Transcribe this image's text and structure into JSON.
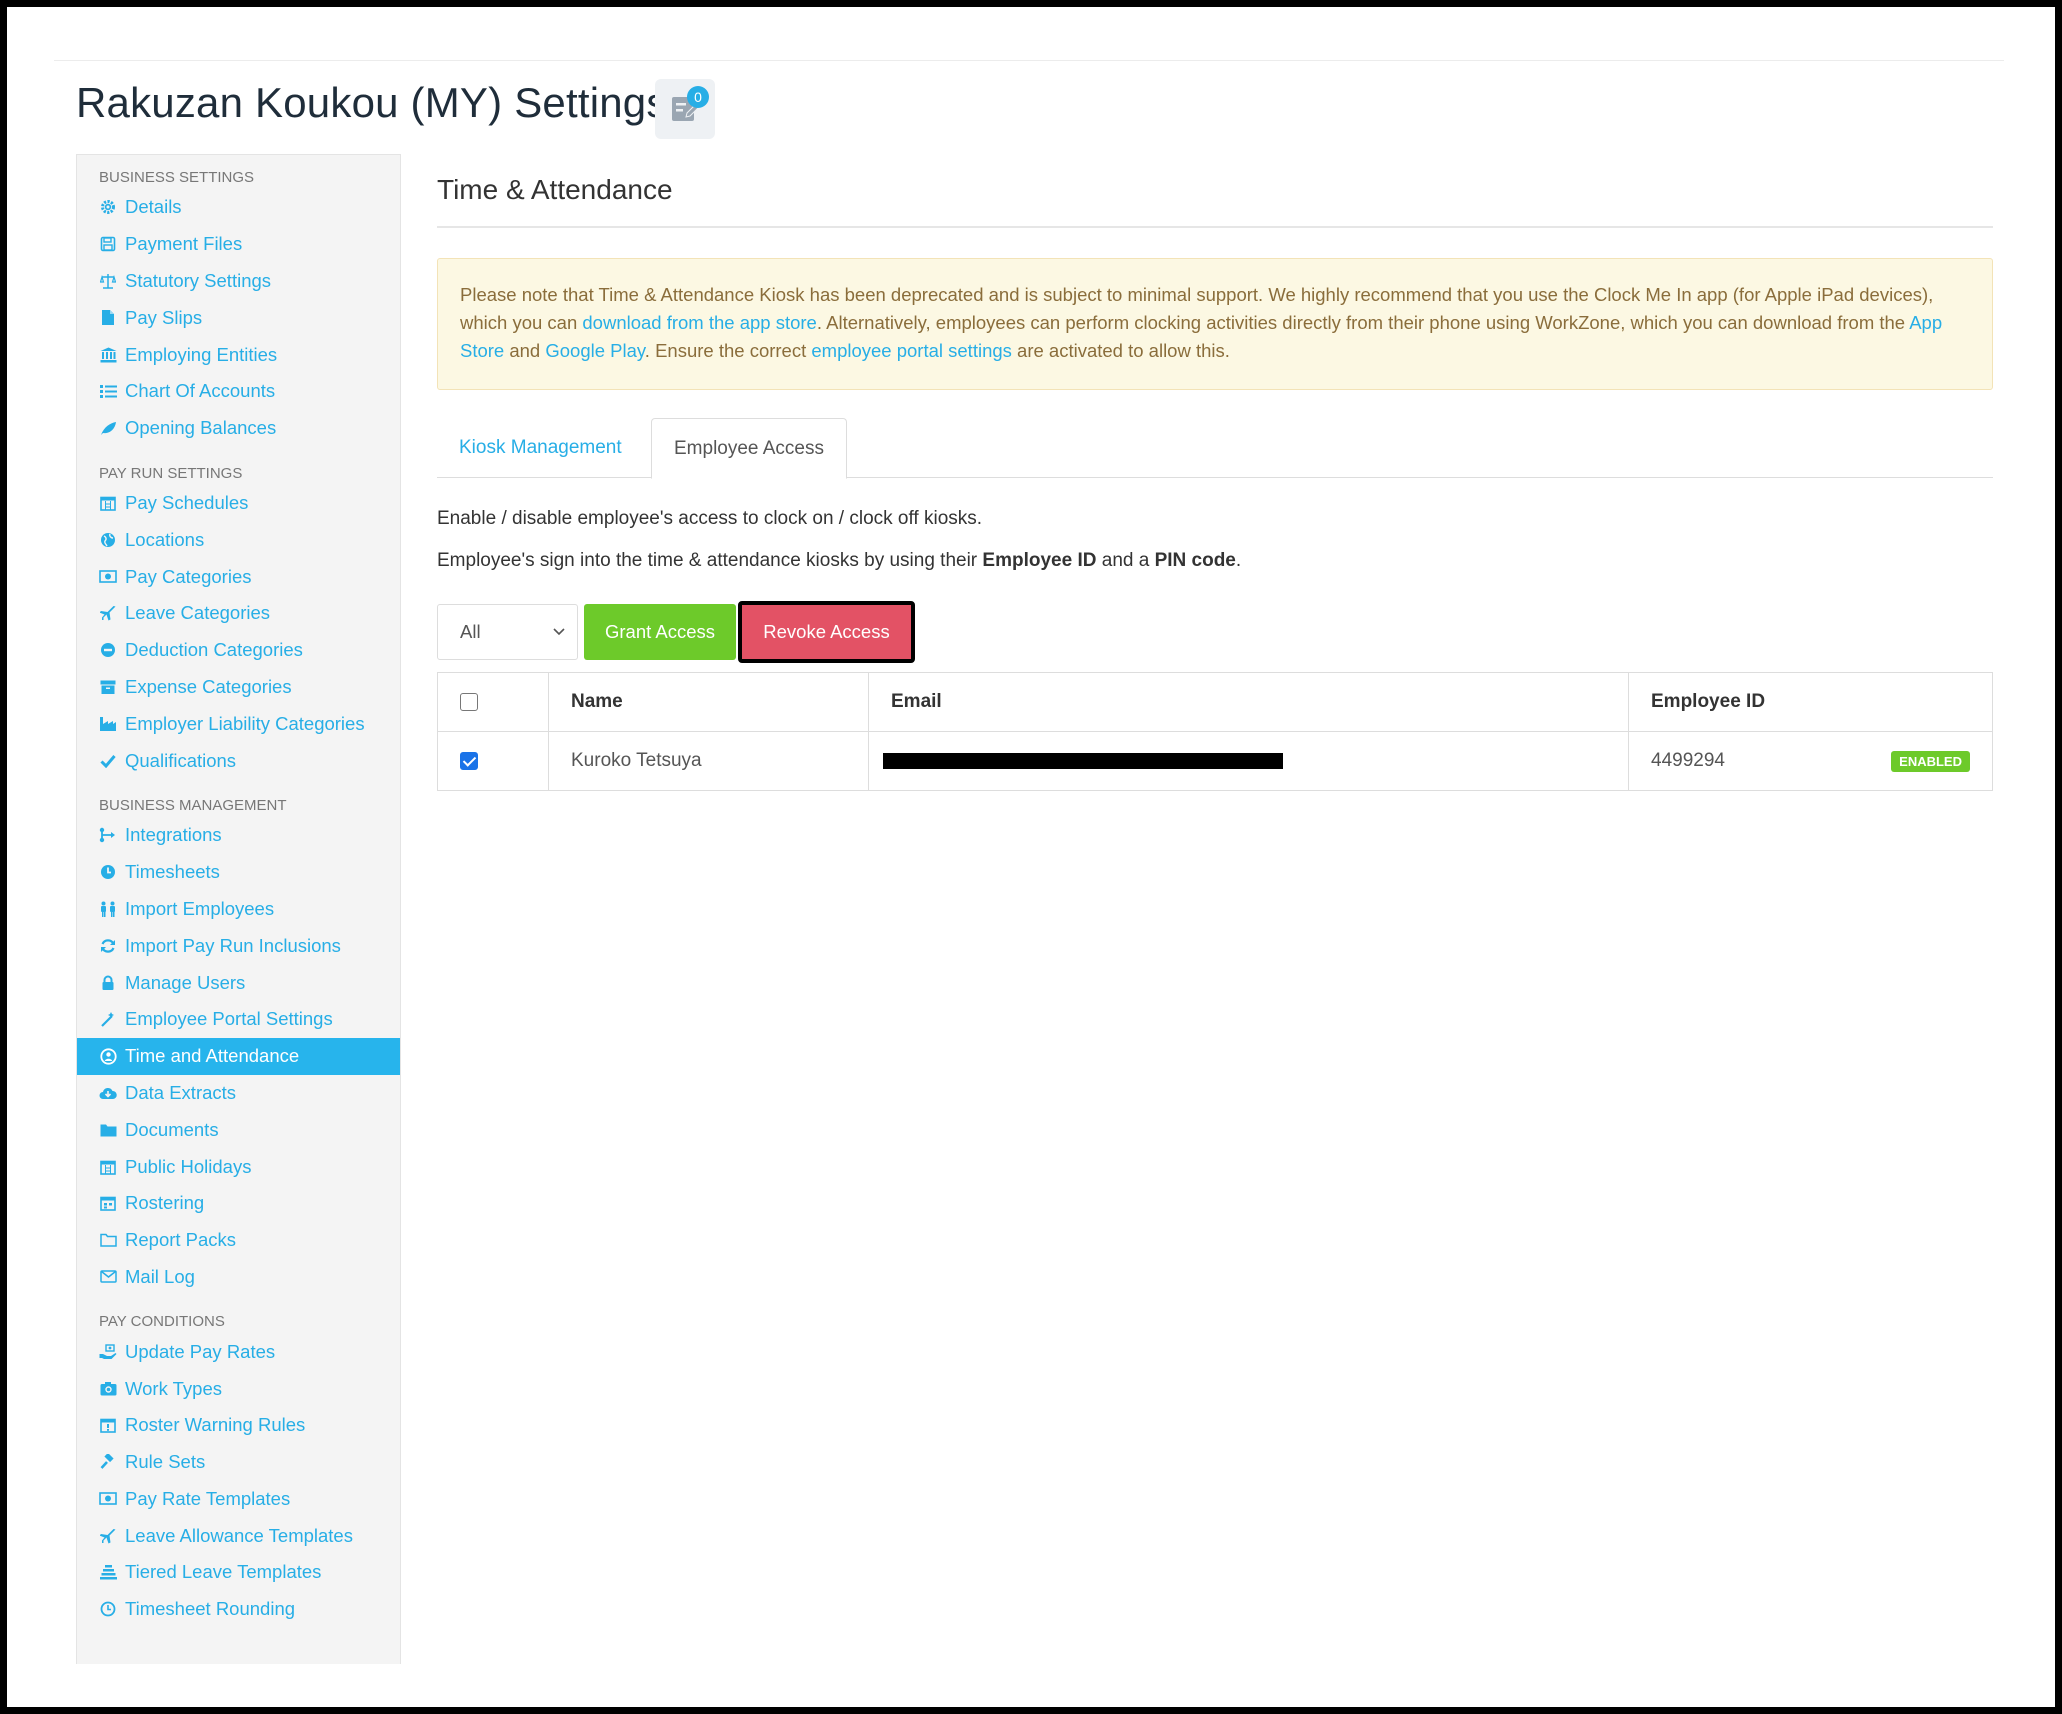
{
  "page": {
    "title": "Rakuzan Koukou (MY) Settings",
    "notes_count": "0"
  },
  "sidebar": {
    "sections": [
      {
        "heading": "BUSINESS SETTINGS",
        "items": [
          {
            "label": "Details",
            "icon": "gear-icon"
          },
          {
            "label": "Payment Files",
            "icon": "floppy-icon"
          },
          {
            "label": "Statutory Settings",
            "icon": "scale-icon"
          },
          {
            "label": "Pay Slips",
            "icon": "file-icon"
          },
          {
            "label": "Employing Entities",
            "icon": "bank-icon"
          },
          {
            "label": "Chart Of Accounts",
            "icon": "list-icon"
          },
          {
            "label": "Opening Balances",
            "icon": "leaf-icon"
          }
        ]
      },
      {
        "heading": "PAY RUN SETTINGS",
        "items": [
          {
            "label": "Pay Schedules",
            "icon": "calendar-icon"
          },
          {
            "label": "Locations",
            "icon": "globe-icon"
          },
          {
            "label": "Pay Categories",
            "icon": "money-icon"
          },
          {
            "label": "Leave Categories",
            "icon": "plane-icon"
          },
          {
            "label": "Deduction Categories",
            "icon": "minus-circle-icon"
          },
          {
            "label": "Expense Categories",
            "icon": "archive-icon"
          },
          {
            "label": "Employer Liability Categories",
            "icon": "industry-icon"
          },
          {
            "label": "Qualifications",
            "icon": "check-icon"
          }
        ]
      },
      {
        "heading": "BUSINESS MANAGEMENT",
        "items": [
          {
            "label": "Integrations",
            "icon": "integration-icon"
          },
          {
            "label": "Timesheets",
            "icon": "clock-icon"
          },
          {
            "label": "Import Employees",
            "icon": "users-icon"
          },
          {
            "label": "Import Pay Run Inclusions",
            "icon": "refresh-icon"
          },
          {
            "label": "Manage Users",
            "icon": "lock-icon"
          },
          {
            "label": "Employee Portal Settings",
            "icon": "wand-icon"
          },
          {
            "label": "Time and Attendance",
            "icon": "user-clock-icon",
            "active": true
          },
          {
            "label": "Data Extracts",
            "icon": "cloud-download-icon"
          },
          {
            "label": "Documents",
            "icon": "folder-icon"
          },
          {
            "label": "Public Holidays",
            "icon": "calendar-icon"
          },
          {
            "label": "Rostering",
            "icon": "calendar-check-icon"
          },
          {
            "label": "Report Packs",
            "icon": "folder-open-icon"
          },
          {
            "label": "Mail Log",
            "icon": "envelope-icon"
          }
        ]
      },
      {
        "heading": "PAY CONDITIONS",
        "items": [
          {
            "label": "Update Pay Rates",
            "icon": "hand-money-icon"
          },
          {
            "label": "Work Types",
            "icon": "camera-icon"
          },
          {
            "label": "Roster Warning Rules",
            "icon": "calendar-warning-icon"
          },
          {
            "label": "Rule Sets",
            "icon": "gavel-icon"
          },
          {
            "label": "Pay Rate Templates",
            "icon": "money-icon"
          },
          {
            "label": "Leave Allowance Templates",
            "icon": "plane-icon"
          },
          {
            "label": "Tiered Leave Templates",
            "icon": "tiers-icon"
          },
          {
            "label": "Timesheet Rounding",
            "icon": "clock-o-icon"
          }
        ]
      }
    ]
  },
  "main": {
    "section_title": "Time & Attendance",
    "alert": {
      "p1": "Please note that Time & Attendance Kiosk has been deprecated and is subject to minimal support. We highly recommend that you use the Clock Me In app (for Apple iPad devices), which you can ",
      "link1": "download from the app store",
      "p2": ". Alternatively, employees can perform clocking activities directly from their phone using WorkZone, which you can download from the ",
      "link2": "App Store",
      "p3": " and ",
      "link3": "Google Play",
      "p4": ". Ensure the correct ",
      "link4": "employee portal settings",
      "p5": " are activated to allow this."
    },
    "tabs": {
      "kiosk": "Kiosk Management",
      "employee": "Employee Access"
    },
    "desc1": "Enable / disable employee's access to clock on / clock off kiosks.",
    "desc2": {
      "a": "Employee's sign into the time & attendance kiosks by using their ",
      "b": "Employee ID",
      "c": " and a ",
      "d": "PIN code",
      "e": "."
    },
    "filter": {
      "selected": "All"
    },
    "buttons": {
      "grant": "Grant Access",
      "revoke": "Revoke Access"
    },
    "table": {
      "headers": {
        "name": "Name",
        "email": "Email",
        "employee_id": "Employee ID"
      },
      "rows": [
        {
          "checked": true,
          "name": "Kuroko Tetsuya",
          "email": "",
          "employee_id": "4499294",
          "status": "ENABLED"
        }
      ]
    }
  },
  "colors": {
    "accent": "#27aee6",
    "active_nav": "#27b4ec",
    "grant": "#6dca2a",
    "revoke": "#e35265",
    "alert_bg": "#fcf8e3",
    "alert_text": "#8a6d3b"
  }
}
